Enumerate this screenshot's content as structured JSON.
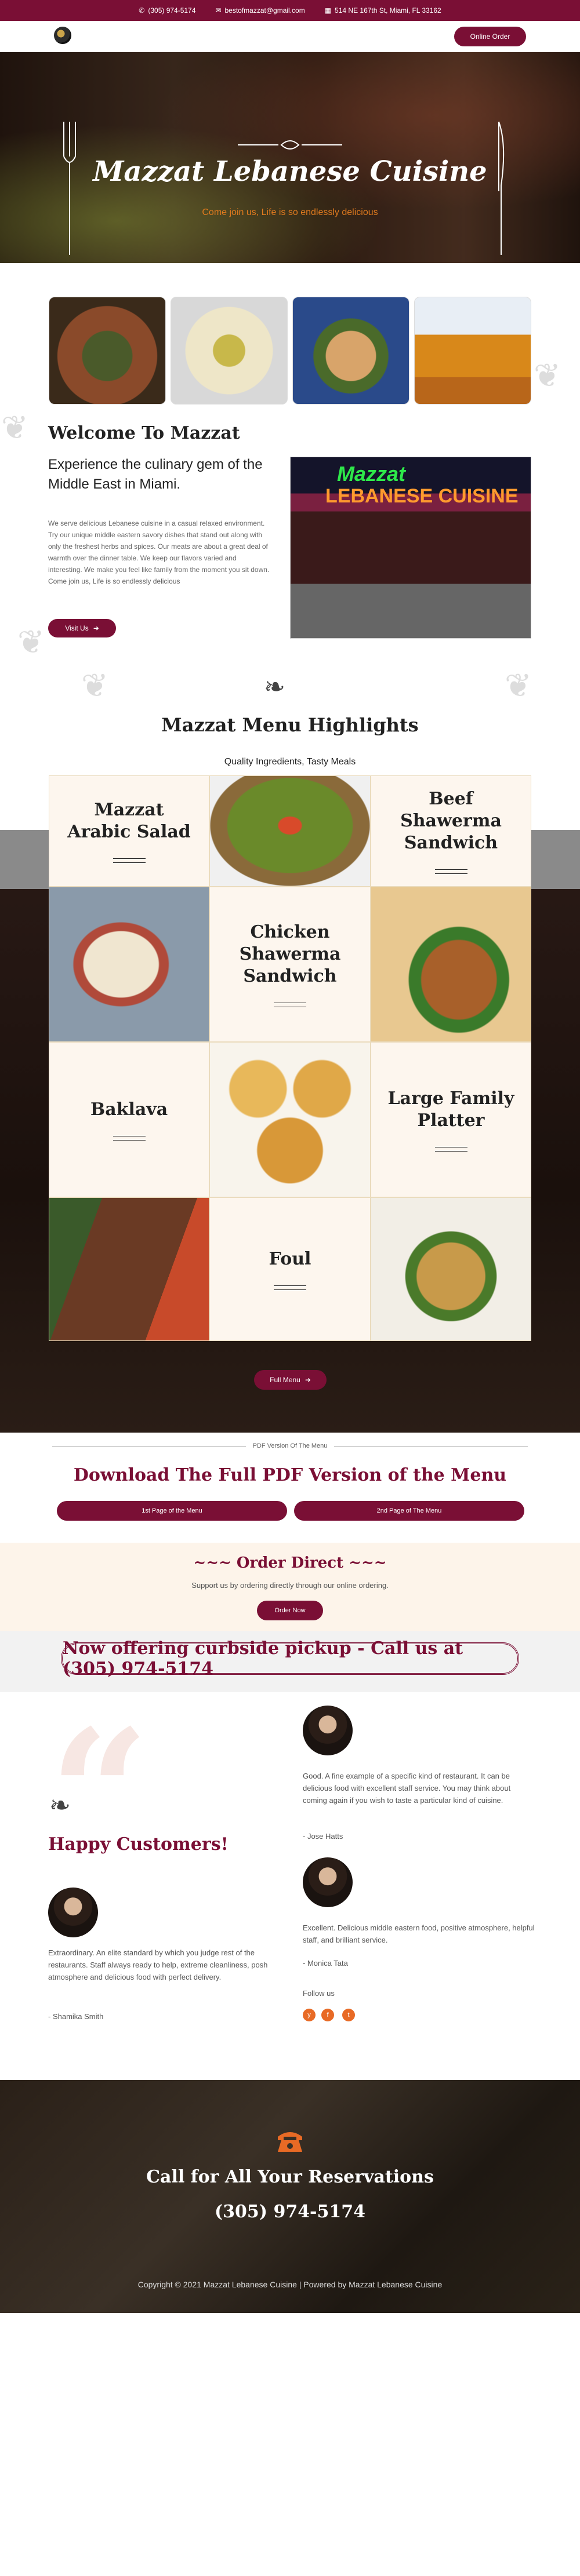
{
  "topbar": {
    "phone": "(305) 974-5174",
    "email": "bestofmazzat@gmail.com",
    "address": "514 NE 167th St, Miami, FL 33162"
  },
  "header": {
    "order_label": "Online Order"
  },
  "hero": {
    "title": "Mazzat Lebanese Cuisine",
    "subtitle": "Come join us, Life is so endlessly delicious"
  },
  "welcome": {
    "title": "Welcome To Mazzat",
    "subtitle": "Experience the culinary gem of the Middle East in Miami.",
    "text": "We serve delicious Lebanese cuisine in a casual relaxed environment. Try our unique middle eastern savory dishes that stand out along with only the freshest herbs and spices. Our meats are about a great deal of warmth over the dinner table. We keep our flavors varied and interesting. We make you feel like family from the moment you sit down. Come join us, Life is so endlessly delicious",
    "button": "Visit Us",
    "sign1": "Mazzat",
    "sign2": "LEBANESE CUISINE"
  },
  "menu": {
    "title": "Mazzat Menu Highlights",
    "subtitle": "Quality Ingredients, Tasty Meals",
    "items": [
      "Mazzat Arabic Salad",
      "Beef Shawerma Sandwich",
      "Chicken Shawerma Sandwich",
      "Baklava",
      "Large Family Platter",
      "Foul"
    ],
    "button": "Full Menu"
  },
  "pdf": {
    "label": "PDF Version Of The Menu",
    "title": "Download The Full PDF Version of the Menu",
    "btn1": "1st Page of the Menu",
    "btn2": "2nd Page of The Menu"
  },
  "order_direct": {
    "title": "~~~ Order Direct ~~~",
    "text": "Support us by ordering directly through our online ordering.",
    "button": "Order Now"
  },
  "curbside": {
    "text": "Now offering curbside pickup - Call us at (305) 974-5174"
  },
  "testimonials": {
    "heading": "Happy Customers!",
    "t1": {
      "text": "Good. A fine example of a specific kind of restaurant. It can be delicious food with excellent staff service. You may think about coming again if you wish to taste a particular kind of cuisine.",
      "author": "- Jose Hatts"
    },
    "t2": {
      "text": "Excellent. Delicious middle eastern food, positive atmosphere, helpful staff, and brilliant service.",
      "author": "- Monica Tata"
    },
    "t3": {
      "text": "Extraordinary. An elite standard by which you judge rest of the restaurants. Staff always ready to help, extreme cleanliness, posh atmosphere and delicious food with perfect delivery.",
      "author": "- Shamika Smith"
    },
    "follow": "Follow us"
  },
  "footer": {
    "heading": "Call for All Your Reservations",
    "phone": "(305) 974-5174",
    "copyright": "Copyright © 2021 Mazzat Lebanese Cuisine | Powered by Mazzat Lebanese Cuisine"
  },
  "colors": {
    "brand": "#7a0f35",
    "accent": "#e86a25"
  }
}
